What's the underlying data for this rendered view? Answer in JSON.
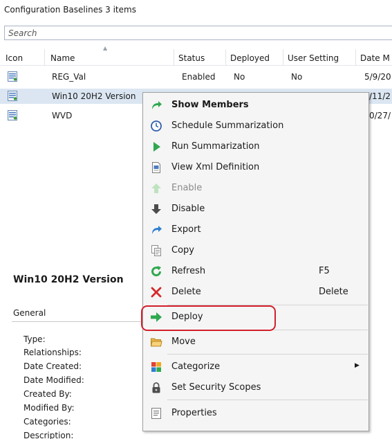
{
  "header": {
    "title": "Configuration Baselines 3 items"
  },
  "search": {
    "placeholder": "Search"
  },
  "grid": {
    "columns": [
      {
        "label": "Icon"
      },
      {
        "label": "Name"
      },
      {
        "label": "Status"
      },
      {
        "label": "Deployed"
      },
      {
        "label": "User Setting"
      },
      {
        "label": "Date M"
      }
    ],
    "rows": [
      {
        "name": "REG_Val",
        "status": "Enabled",
        "deployed": "No",
        "user_setting": "No",
        "date": "5/9/20"
      },
      {
        "name": "Win10 20H2 Version",
        "status": "",
        "deployed": "",
        "user_setting": "",
        "date": "/11/2"
      },
      {
        "name": "WVD",
        "status": "",
        "deployed": "",
        "user_setting": "",
        "date": "0/27/"
      }
    ]
  },
  "details": {
    "title": "Win10 20H2 Version",
    "section": "General",
    "properties": [
      "Type:",
      "Relationships:",
      "Date Created:",
      "Date Modified:",
      "Created By:",
      "Modified By:",
      "Categories:",
      "Description:"
    ]
  },
  "context_menu": {
    "items": [
      {
        "label": "Show Members",
        "icon": "green-curved-arrow-icon"
      },
      {
        "label": "Schedule Summarization",
        "icon": "clock-icon"
      },
      {
        "label": "Run Summarization",
        "icon": "green-play-icon"
      },
      {
        "label": "View Xml Definition",
        "icon": "xml-document-icon"
      },
      {
        "label": "Enable",
        "icon": "up-arrow-icon"
      },
      {
        "label": "Disable",
        "icon": "down-arrow-icon"
      },
      {
        "label": "Export",
        "icon": "blue-curved-arrow-icon"
      },
      {
        "label": "Copy",
        "icon": "copy-icon"
      },
      {
        "label": "Refresh",
        "shortcut": "F5",
        "icon": "refresh-icon"
      },
      {
        "label": "Delete",
        "shortcut": "Delete",
        "icon": "red-x-icon"
      },
      {
        "label": "Deploy",
        "icon": "green-right-arrow-icon"
      },
      {
        "label": "Move",
        "icon": "folder-icon"
      },
      {
        "label": "Categorize",
        "icon": "categorize-icon"
      },
      {
        "label": "Set Security Scopes",
        "icon": "padlock-icon"
      },
      {
        "label": "Properties",
        "icon": "properties-icon"
      }
    ]
  },
  "colors": {
    "selection": "#dbe6f2",
    "highlight_border": "#d21f2b",
    "menu_background": "#f5f5f5"
  }
}
